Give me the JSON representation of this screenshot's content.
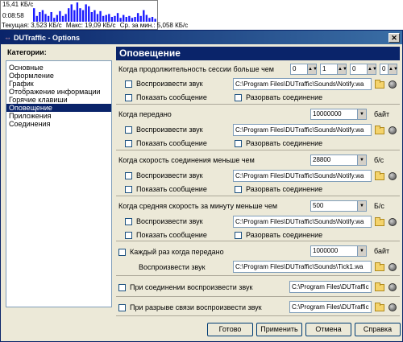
{
  "widget": {
    "speed_label": "15,41 КБ/с",
    "time_label": "0:08:58",
    "stats_current": "Текущая: 3,523 КБ/с",
    "stats_max": "Макс: 19,09 КБ/с",
    "stats_avg": "Ср. за мин.: 5,058 КБ/с",
    "bar_color": "#1a1aff",
    "bar_values": [
      0.7,
      0.3,
      0.5,
      0.6,
      0.4,
      0.3,
      0.5,
      0.2,
      0.35,
      0.55,
      0.3,
      0.4,
      0.7,
      0.9,
      0.6,
      1.0,
      0.7,
      0.6,
      0.9,
      0.8,
      0.5,
      0.6,
      0.4,
      0.55,
      0.3,
      0.35,
      0.4,
      0.25,
      0.3,
      0.45,
      0.2,
      0.35,
      0.25,
      0.3,
      0.2,
      0.25,
      0.45,
      0.3,
      0.6,
      0.35,
      0.2,
      0.25,
      0.15
    ]
  },
  "window": {
    "title": "DUTraffic - Options"
  },
  "categories": {
    "heading": "Категории:",
    "items": [
      "Основные",
      "Оформление",
      "График",
      "Отображение информации",
      "Горячие клавиши",
      "Оповещение",
      "Приложения",
      "Соединения"
    ],
    "selected_index": 5
  },
  "section": {
    "title": "Оповещение"
  },
  "group1": {
    "title": "Когда продолжительность сессии больше чем",
    "spin_values": [
      "0",
      "1",
      "0",
      "0"
    ],
    "play_sound": "Воспроизвести звук",
    "show_msg": "Показать сообщение",
    "disconnect": "Разорвать соединение",
    "path": "C:\\Program Files\\DUTraffic\\Sounds\\Notify.wa"
  },
  "group2": {
    "title": "Когда передано",
    "value": "10000000",
    "unit": "байт",
    "play_sound": "Воспроизвести звук",
    "show_msg": "Показать сообщение",
    "disconnect": "Разорвать соединение",
    "path": "C:\\Program Files\\DUTraffic\\Sounds\\Notify.wa"
  },
  "group3": {
    "title": "Когда скорость соединения меньше чем",
    "value": "28800",
    "unit": "б/с",
    "play_sound": "Воспроизвести звук",
    "show_msg": "Показать сообщение",
    "disconnect": "Разорвать соединение",
    "path": "C:\\Program Files\\DUTraffic\\Sounds\\Notify.wa"
  },
  "group4": {
    "title": "Когда средняя скорость за минуту меньше чем",
    "value": "500",
    "unit": "Б/с",
    "play_sound": "Воспроизвести звук",
    "show_msg": "Показать сообщение",
    "disconnect": "Разорвать соединение",
    "path": "C:\\Program Files\\DUTraffic\\Sounds\\Notify.wa"
  },
  "group5": {
    "title": "Каждый раз когда передано",
    "value": "1000000",
    "unit": "байт",
    "play_sound": "Воспроизвести звук",
    "path": "C:\\Program Files\\DUTraffic\\Sounds\\Tick1.wa"
  },
  "group6": {
    "title": "При соединении воспроизвести звук",
    "path": "C:\\Program Files\\DUTraffic"
  },
  "group7": {
    "title": "При разрыве связи воспроизвести звук",
    "path": "C:\\Program Files\\DUTraffic"
  },
  "buttons": {
    "ok": "Готово",
    "apply": "Применить",
    "cancel": "Отмена",
    "help": "Справка"
  }
}
